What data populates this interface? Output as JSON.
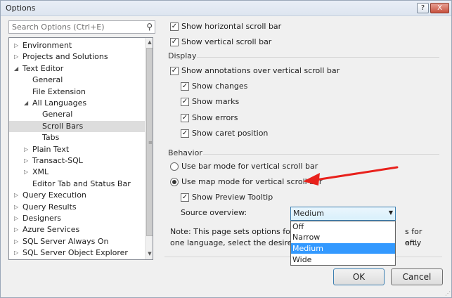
{
  "window": {
    "title": "Options",
    "help_label": "?",
    "close_label": "X"
  },
  "search": {
    "placeholder": "Search Options (Ctrl+E)"
  },
  "tree": {
    "items": [
      {
        "label": "Environment",
        "arrow": "▷",
        "level": 0
      },
      {
        "label": "Projects and Solutions",
        "arrow": "▷",
        "level": 0
      },
      {
        "label": "Text Editor",
        "arrow": "◢",
        "level": 0
      },
      {
        "label": "General",
        "arrow": "",
        "level": 1
      },
      {
        "label": "File Extension",
        "arrow": "",
        "level": 1
      },
      {
        "label": "All Languages",
        "arrow": "◢",
        "level": 1
      },
      {
        "label": "General",
        "arrow": "",
        "level": 2
      },
      {
        "label": "Scroll Bars",
        "arrow": "",
        "level": 2,
        "selected": true
      },
      {
        "label": "Tabs",
        "arrow": "",
        "level": 2
      },
      {
        "label": "Plain Text",
        "arrow": "▷",
        "level": 1
      },
      {
        "label": "Transact-SQL",
        "arrow": "▷",
        "level": 1
      },
      {
        "label": "XML",
        "arrow": "▷",
        "level": 1
      },
      {
        "label": "Editor Tab and Status Bar",
        "arrow": "",
        "level": 1
      },
      {
        "label": "Query Execution",
        "arrow": "▷",
        "level": 0
      },
      {
        "label": "Query Results",
        "arrow": "▷",
        "level": 0
      },
      {
        "label": "Designers",
        "arrow": "▷",
        "level": 0
      },
      {
        "label": "Azure Services",
        "arrow": "▷",
        "level": 0
      },
      {
        "label": "SQL Server Always On",
        "arrow": "▷",
        "level": 0
      },
      {
        "label": "SQL Server Object Explorer",
        "arrow": "▷",
        "level": 0
      }
    ]
  },
  "options": {
    "show_hscroll": {
      "label": "Show horizontal scroll bar",
      "checked": true
    },
    "show_vscroll": {
      "label": "Show vertical scroll bar",
      "checked": true
    },
    "display_header": "Display",
    "show_annotations": {
      "label": "Show annotations over vertical scroll bar",
      "checked": true
    },
    "show_changes": {
      "label": "Show changes",
      "checked": true
    },
    "show_marks": {
      "label": "Show marks",
      "checked": true
    },
    "show_errors": {
      "label": "Show errors",
      "checked": true
    },
    "show_caret": {
      "label": "Show caret position",
      "checked": true
    },
    "behavior_header": "Behavior",
    "bar_mode": {
      "label": "Use bar mode for vertical scroll bar",
      "selected": false
    },
    "map_mode": {
      "label": "Use map mode for vertical scroll bar",
      "selected": true
    },
    "preview_tooltip": {
      "label": "Show Preview Tooltip",
      "checked": true
    },
    "source_overview_label": "Source overview:",
    "source_overview_value": "Medium",
    "source_overview_options": [
      "Off",
      "Narrow",
      "Medium",
      "Wide"
    ],
    "highlighted_option": "Medium"
  },
  "note": {
    "line1": "Note: This page sets options for all languages. To change options for only",
    "line2": "one language, select the desired language from the tree on the left.",
    "line1_visible_start": "Note: This page sets options for all",
    "line1_visible_end": "s for only",
    "line2_visible_start": "one language, select the desired la",
    "line2_visible_end": "eft."
  },
  "buttons": {
    "ok": "OK",
    "cancel": "Cancel"
  },
  "glyphs": {
    "check": "✓",
    "search_icon": "⚲",
    "dropdown_arrow": "▼",
    "scroll_up": "▲",
    "scroll_down": "▼",
    "scroll_grip": "≡",
    "resize_grip": "⋰"
  },
  "colors": {
    "arrow_red": "#e8211c",
    "selection": "#3399ff",
    "dropdown_border": "#3c7fb1"
  }
}
